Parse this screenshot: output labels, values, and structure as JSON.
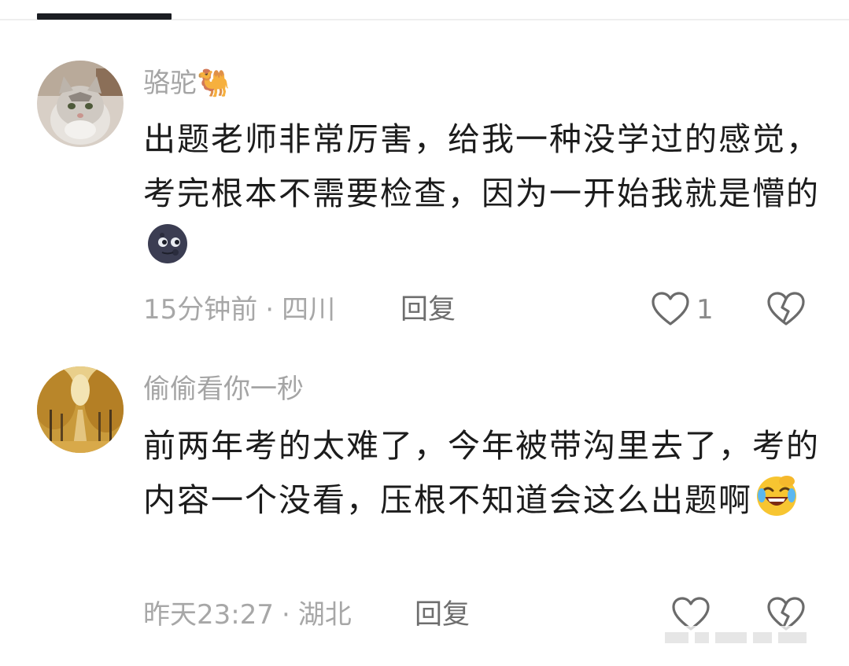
{
  "comments": [
    {
      "username": "骆驼🐫",
      "text": "出题老师非常厉害，给我一种没学过的感觉，考完根本不需要检查，因为一开始我就是懵的",
      "emoji": "new-moon-face",
      "time": "15分钟前",
      "separator": "·",
      "location": "四川",
      "reply_label": "回复",
      "like_count": "1"
    },
    {
      "username": "偷偷看你一秒",
      "text": "前两年考的太难了，今年被带沟里去了，考的内容一个没看，压根不知道会这么出题啊",
      "emoji": "rolling-laughing-face",
      "time": "昨天23:27",
      "separator": "·",
      "location": "湖北",
      "reply_label": "回复",
      "like_count": ""
    }
  ],
  "colors": {
    "text": "#1c1c1c",
    "meta": "#a7a7a7",
    "icon": "#6b6b6b"
  },
  "icons": {
    "like": "heart-outline-icon",
    "dislike": "broken-heart-icon"
  }
}
